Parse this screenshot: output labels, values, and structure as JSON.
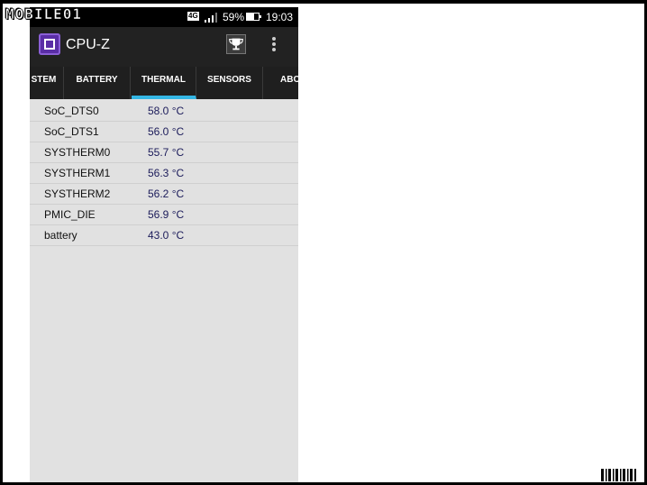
{
  "watermark": "MOBILE01",
  "status_bar": {
    "network": "4G",
    "battery_percent": "59%",
    "battery_level": 0.59,
    "time": "19:03"
  },
  "app": {
    "title": "CPU-Z",
    "icons": [
      "cpu-chip-icon",
      "trophy-icon",
      "overflow-menu-icon"
    ]
  },
  "tabs": [
    {
      "label": "STEM"
    },
    {
      "label": "BATTERY"
    },
    {
      "label": "THERMAL",
      "active": true
    },
    {
      "label": "SENSORS"
    },
    {
      "label": "ABO"
    }
  ],
  "thermal": [
    {
      "name": "SoC_DTS0",
      "value": "58.0 °C"
    },
    {
      "name": "SoC_DTS1",
      "value": "56.0 °C"
    },
    {
      "name": "SYSTHERM0",
      "value": "55.7 °C"
    },
    {
      "name": "SYSTHERM1",
      "value": "56.3 °C"
    },
    {
      "name": "SYSTHERM2",
      "value": "56.2 °C"
    },
    {
      "name": "PMIC_DIE",
      "value": "56.9 °C"
    },
    {
      "name": "battery",
      "value": "43.0 °C"
    }
  ],
  "colors": {
    "accent": "#34b6e4",
    "app_bar": "#222222",
    "list_bg": "#e1e1e1",
    "logo": "#5a2ea6"
  }
}
